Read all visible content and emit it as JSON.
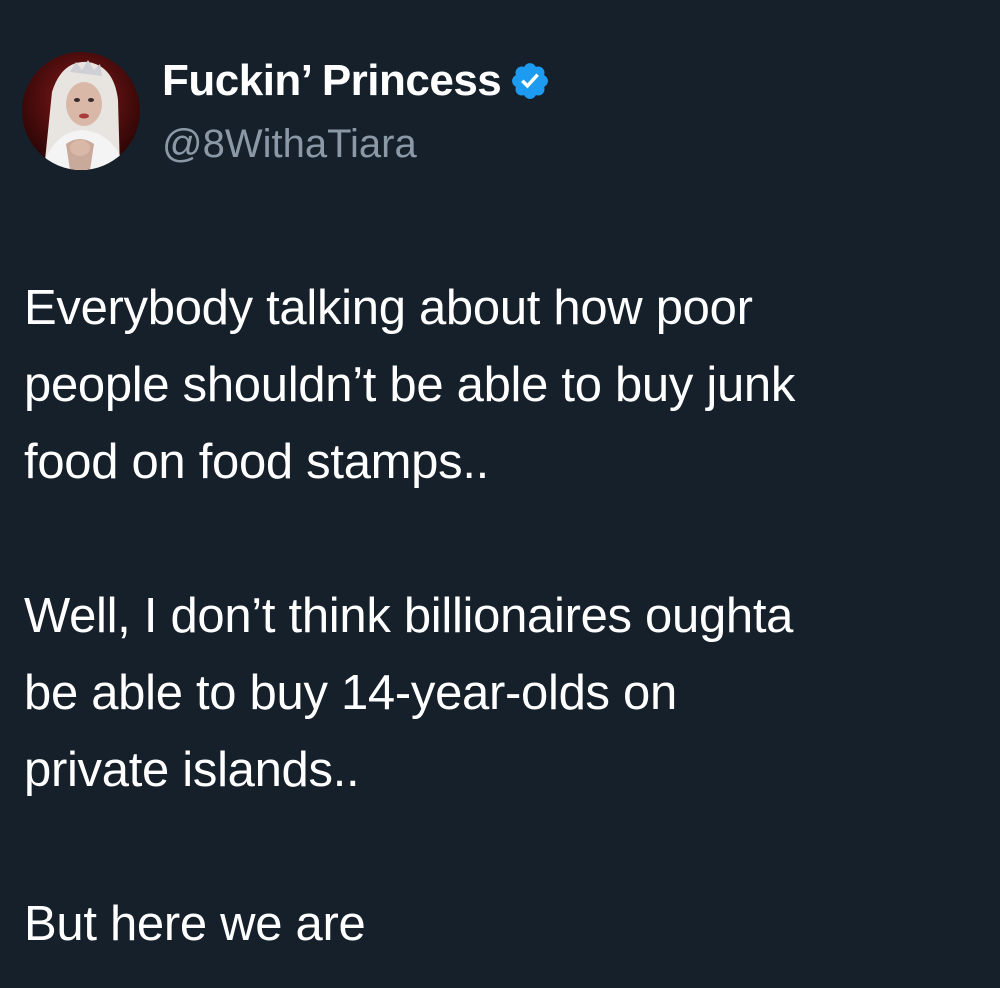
{
  "tweet": {
    "author": {
      "display_name": "Fuckin’ Princess",
      "handle": "@8WithaTiara",
      "verified": true,
      "avatar_icon": "avatar-photo"
    },
    "paragraphs": [
      "Everybody talking about how poor\npeople shouldn’t be able to buy junk\nfood on food stamps..",
      "Well, I don’t think billionaires oughta\nbe able to buy 14-year-olds on\nprivate islands..",
      "But here we are"
    ]
  },
  "colors": {
    "background": "#15202b",
    "text": "#ffffff",
    "handle": "#8b98a5",
    "verified_badge": "#1d9bf0"
  }
}
